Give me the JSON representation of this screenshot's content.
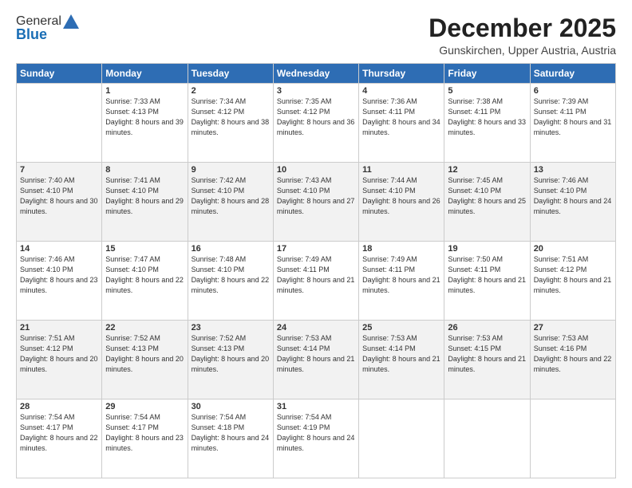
{
  "logo": {
    "general": "General",
    "blue": "Blue"
  },
  "header": {
    "month": "December 2025",
    "location": "Gunskirchen, Upper Austria, Austria"
  },
  "days_of_week": [
    "Sunday",
    "Monday",
    "Tuesday",
    "Wednesday",
    "Thursday",
    "Friday",
    "Saturday"
  ],
  "weeks": [
    [
      {
        "day": "",
        "sunrise": "",
        "sunset": "",
        "daylight": ""
      },
      {
        "day": "1",
        "sunrise": "Sunrise: 7:33 AM",
        "sunset": "Sunset: 4:13 PM",
        "daylight": "Daylight: 8 hours and 39 minutes."
      },
      {
        "day": "2",
        "sunrise": "Sunrise: 7:34 AM",
        "sunset": "Sunset: 4:12 PM",
        "daylight": "Daylight: 8 hours and 38 minutes."
      },
      {
        "day": "3",
        "sunrise": "Sunrise: 7:35 AM",
        "sunset": "Sunset: 4:12 PM",
        "daylight": "Daylight: 8 hours and 36 minutes."
      },
      {
        "day": "4",
        "sunrise": "Sunrise: 7:36 AM",
        "sunset": "Sunset: 4:11 PM",
        "daylight": "Daylight: 8 hours and 34 minutes."
      },
      {
        "day": "5",
        "sunrise": "Sunrise: 7:38 AM",
        "sunset": "Sunset: 4:11 PM",
        "daylight": "Daylight: 8 hours and 33 minutes."
      },
      {
        "day": "6",
        "sunrise": "Sunrise: 7:39 AM",
        "sunset": "Sunset: 4:11 PM",
        "daylight": "Daylight: 8 hours and 31 minutes."
      }
    ],
    [
      {
        "day": "7",
        "sunrise": "Sunrise: 7:40 AM",
        "sunset": "Sunset: 4:10 PM",
        "daylight": "Daylight: 8 hours and 30 minutes."
      },
      {
        "day": "8",
        "sunrise": "Sunrise: 7:41 AM",
        "sunset": "Sunset: 4:10 PM",
        "daylight": "Daylight: 8 hours and 29 minutes."
      },
      {
        "day": "9",
        "sunrise": "Sunrise: 7:42 AM",
        "sunset": "Sunset: 4:10 PM",
        "daylight": "Daylight: 8 hours and 28 minutes."
      },
      {
        "day": "10",
        "sunrise": "Sunrise: 7:43 AM",
        "sunset": "Sunset: 4:10 PM",
        "daylight": "Daylight: 8 hours and 27 minutes."
      },
      {
        "day": "11",
        "sunrise": "Sunrise: 7:44 AM",
        "sunset": "Sunset: 4:10 PM",
        "daylight": "Daylight: 8 hours and 26 minutes."
      },
      {
        "day": "12",
        "sunrise": "Sunrise: 7:45 AM",
        "sunset": "Sunset: 4:10 PM",
        "daylight": "Daylight: 8 hours and 25 minutes."
      },
      {
        "day": "13",
        "sunrise": "Sunrise: 7:46 AM",
        "sunset": "Sunset: 4:10 PM",
        "daylight": "Daylight: 8 hours and 24 minutes."
      }
    ],
    [
      {
        "day": "14",
        "sunrise": "Sunrise: 7:46 AM",
        "sunset": "Sunset: 4:10 PM",
        "daylight": "Daylight: 8 hours and 23 minutes."
      },
      {
        "day": "15",
        "sunrise": "Sunrise: 7:47 AM",
        "sunset": "Sunset: 4:10 PM",
        "daylight": "Daylight: 8 hours and 22 minutes."
      },
      {
        "day": "16",
        "sunrise": "Sunrise: 7:48 AM",
        "sunset": "Sunset: 4:10 PM",
        "daylight": "Daylight: 8 hours and 22 minutes."
      },
      {
        "day": "17",
        "sunrise": "Sunrise: 7:49 AM",
        "sunset": "Sunset: 4:11 PM",
        "daylight": "Daylight: 8 hours and 21 minutes."
      },
      {
        "day": "18",
        "sunrise": "Sunrise: 7:49 AM",
        "sunset": "Sunset: 4:11 PM",
        "daylight": "Daylight: 8 hours and 21 minutes."
      },
      {
        "day": "19",
        "sunrise": "Sunrise: 7:50 AM",
        "sunset": "Sunset: 4:11 PM",
        "daylight": "Daylight: 8 hours and 21 minutes."
      },
      {
        "day": "20",
        "sunrise": "Sunrise: 7:51 AM",
        "sunset": "Sunset: 4:12 PM",
        "daylight": "Daylight: 8 hours and 21 minutes."
      }
    ],
    [
      {
        "day": "21",
        "sunrise": "Sunrise: 7:51 AM",
        "sunset": "Sunset: 4:12 PM",
        "daylight": "Daylight: 8 hours and 20 minutes."
      },
      {
        "day": "22",
        "sunrise": "Sunrise: 7:52 AM",
        "sunset": "Sunset: 4:13 PM",
        "daylight": "Daylight: 8 hours and 20 minutes."
      },
      {
        "day": "23",
        "sunrise": "Sunrise: 7:52 AM",
        "sunset": "Sunset: 4:13 PM",
        "daylight": "Daylight: 8 hours and 20 minutes."
      },
      {
        "day": "24",
        "sunrise": "Sunrise: 7:53 AM",
        "sunset": "Sunset: 4:14 PM",
        "daylight": "Daylight: 8 hours and 21 minutes."
      },
      {
        "day": "25",
        "sunrise": "Sunrise: 7:53 AM",
        "sunset": "Sunset: 4:14 PM",
        "daylight": "Daylight: 8 hours and 21 minutes."
      },
      {
        "day": "26",
        "sunrise": "Sunrise: 7:53 AM",
        "sunset": "Sunset: 4:15 PM",
        "daylight": "Daylight: 8 hours and 21 minutes."
      },
      {
        "day": "27",
        "sunrise": "Sunrise: 7:53 AM",
        "sunset": "Sunset: 4:16 PM",
        "daylight": "Daylight: 8 hours and 22 minutes."
      }
    ],
    [
      {
        "day": "28",
        "sunrise": "Sunrise: 7:54 AM",
        "sunset": "Sunset: 4:17 PM",
        "daylight": "Daylight: 8 hours and 22 minutes."
      },
      {
        "day": "29",
        "sunrise": "Sunrise: 7:54 AM",
        "sunset": "Sunset: 4:17 PM",
        "daylight": "Daylight: 8 hours and 23 minutes."
      },
      {
        "day": "30",
        "sunrise": "Sunrise: 7:54 AM",
        "sunset": "Sunset: 4:18 PM",
        "daylight": "Daylight: 8 hours and 24 minutes."
      },
      {
        "day": "31",
        "sunrise": "Sunrise: 7:54 AM",
        "sunset": "Sunset: 4:19 PM",
        "daylight": "Daylight: 8 hours and 24 minutes."
      },
      {
        "day": "",
        "sunrise": "",
        "sunset": "",
        "daylight": ""
      },
      {
        "day": "",
        "sunrise": "",
        "sunset": "",
        "daylight": ""
      },
      {
        "day": "",
        "sunrise": "",
        "sunset": "",
        "daylight": ""
      }
    ]
  ]
}
